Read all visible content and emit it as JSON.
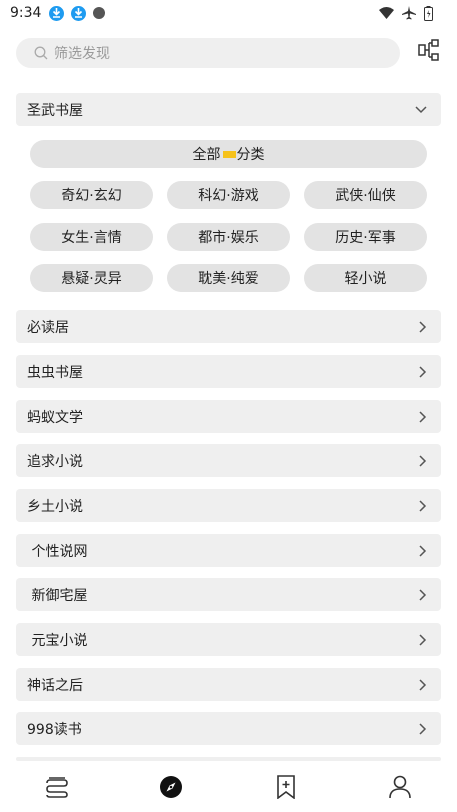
{
  "status_bar": {
    "time": "9:34"
  },
  "search": {
    "placeholder": "筛选发现"
  },
  "source_selector": {
    "label": "圣武书屋"
  },
  "categories": {
    "all_prefix": "全部",
    "all_suffix": "分类",
    "items": [
      "奇幻·玄幻",
      "科幻·游戏",
      "武侠·仙侠",
      "女生·言情",
      "都市·娱乐",
      "历史·军事",
      "悬疑·灵异",
      "耽美·纯爱",
      "轻小说"
    ]
  },
  "sources": [
    "必读居",
    "虫虫书屋",
    "蚂蚁文学",
    "追求小说",
    "乡土小说",
    " 个性说网",
    " 新御宅屋",
    " 元宝小说",
    "神话之后",
    "998读书"
  ],
  "colors": {
    "accent_download": "#1e9bf0",
    "tag_yellow": "#f6c21b",
    "row_bg": "#efefef",
    "chip_bg": "#e3e3e3"
  },
  "icons": {
    "nav": [
      "bookshelf-icon",
      "discover-compass-icon",
      "bookmark-add-icon",
      "profile-icon"
    ]
  }
}
